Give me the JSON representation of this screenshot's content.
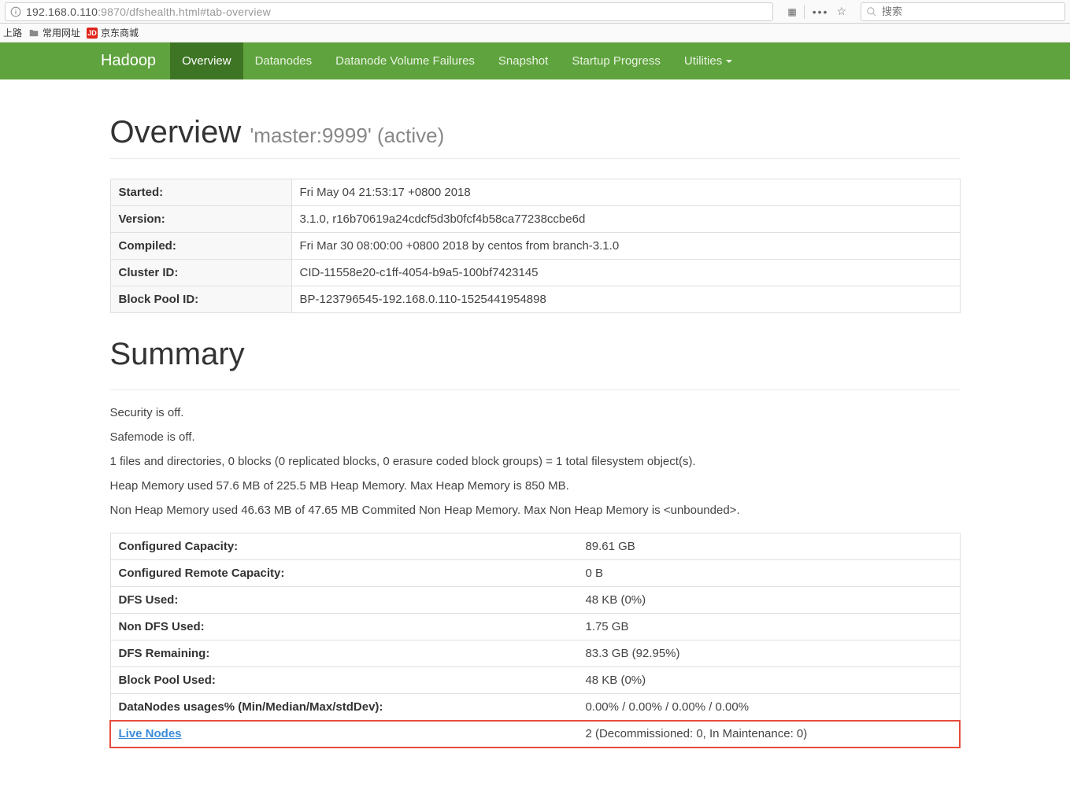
{
  "browser": {
    "url_host": "192.168.0.110",
    "url_rest": ":9870/dfshealth.html#tab-overview",
    "search_placeholder": "搜索"
  },
  "bookmarks": {
    "left_trunc": "上路",
    "common": "常用网址",
    "jd": "京东商城",
    "jd_badge": "JD"
  },
  "nav": {
    "brand": "Hadoop",
    "items": [
      "Overview",
      "Datanodes",
      "Datanode Volume Failures",
      "Snapshot",
      "Startup Progress",
      "Utilities"
    ]
  },
  "overview": {
    "title": "Overview",
    "subtitle": "'master:9999' (active)",
    "rows": [
      {
        "k": "Started:",
        "v": "Fri May 04 21:53:17 +0800 2018"
      },
      {
        "k": "Version:",
        "v": "3.1.0, r16b70619a24cdcf5d3b0fcf4b58ca77238ccbe6d"
      },
      {
        "k": "Compiled:",
        "v": "Fri Mar 30 08:00:00 +0800 2018 by centos from branch-3.1.0"
      },
      {
        "k": "Cluster ID:",
        "v": "CID-11558e20-c1ff-4054-b9a5-100bf7423145"
      },
      {
        "k": "Block Pool ID:",
        "v": "BP-123796545-192.168.0.110-1525441954898"
      }
    ]
  },
  "summary": {
    "title": "Summary",
    "lines": [
      "Security is off.",
      "Safemode is off.",
      "1 files and directories, 0 blocks (0 replicated blocks, 0 erasure coded block groups) = 1 total filesystem object(s).",
      "Heap Memory used 57.6 MB of 225.5 MB Heap Memory. Max Heap Memory is 850 MB.",
      "Non Heap Memory used 46.63 MB of 47.65 MB Commited Non Heap Memory. Max Non Heap Memory is <unbounded>."
    ],
    "table": [
      {
        "k": "Configured Capacity:",
        "v": "89.61 GB"
      },
      {
        "k": "Configured Remote Capacity:",
        "v": "0 B"
      },
      {
        "k": "DFS Used:",
        "v": "48 KB (0%)"
      },
      {
        "k": "Non DFS Used:",
        "v": "1.75 GB"
      },
      {
        "k": "DFS Remaining:",
        "v": "83.3 GB (92.95%)"
      },
      {
        "k": "Block Pool Used:",
        "v": "48 KB (0%)"
      },
      {
        "k": "DataNodes usages% (Min/Median/Max/stdDev):",
        "v": "0.00% / 0.00% / 0.00% / 0.00%"
      },
      {
        "k": "Live Nodes",
        "v": "2 (Decommissioned: 0, In Maintenance: 0)",
        "link": true,
        "highlight": true
      }
    ]
  }
}
